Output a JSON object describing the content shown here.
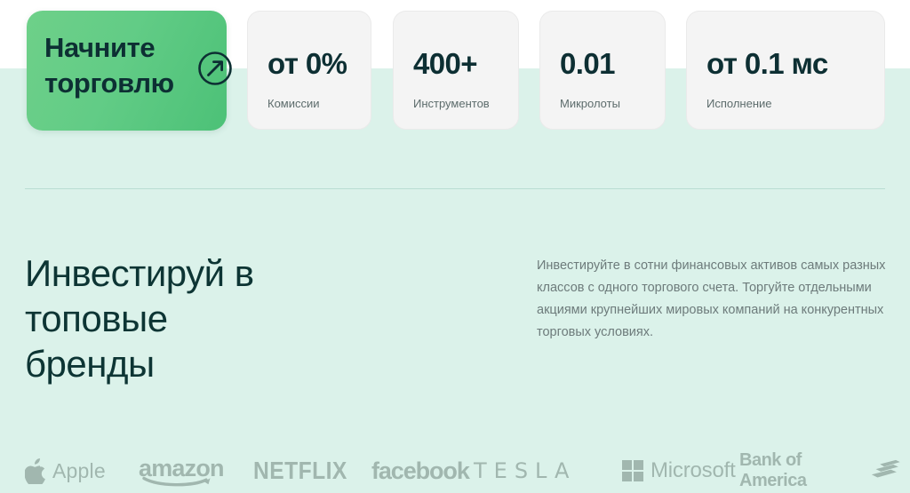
{
  "hero": {
    "cta": {
      "label": "Начните\nторговлю",
      "icon": "arrow-up-right-circle-icon",
      "gradient_from": "#6ed089",
      "gradient_to": "#4cc177",
      "text_color": "#0d2f33"
    },
    "stats": [
      {
        "value": "от 0%",
        "label": "Комиссии"
      },
      {
        "value": "400+",
        "label": "Инструментов"
      },
      {
        "value": "0.01",
        "label": "Микролоты"
      },
      {
        "value": "от 0.1 мс",
        "label": "Исполнение"
      }
    ]
  },
  "content": {
    "heading": "Инвестируй в\nтоповые\nбренды",
    "paragraph": "Инвестируйте в сотни финансовых активов самых разных классов с одного торгового счета. Торгуйте отдельными акциями крупнейших мировых компаний на конкурентных торговых условиях."
  },
  "brands": [
    {
      "name": "Apple",
      "word": "Apple",
      "icon": "apple-logo-icon"
    },
    {
      "name": "Amazon",
      "word": "amazon",
      "icon": "amazon-smile-icon"
    },
    {
      "name": "Netflix",
      "word": "NETFLIX",
      "icon": "netflix-wordmark-icon"
    },
    {
      "name": "Facebook",
      "word": "facebook",
      "icon": "facebook-wordmark-icon"
    },
    {
      "name": "Tesla",
      "word": "TESLA",
      "icon": "tesla-wordmark-icon"
    },
    {
      "name": "Microsoft",
      "word": "Microsoft",
      "icon": "microsoft-squares-icon"
    },
    {
      "name": "Bank of America",
      "word": "Bank of America",
      "icon": "bank-of-america-flag-icon"
    }
  ],
  "theme": {
    "mint_background": "#dbf2ea",
    "white_background": "#ffffff",
    "card_background": "#f4f4f4",
    "heading_color": "#0d3534",
    "paragraph_color": "#6d7b7b",
    "logo_color": "#9db3ab",
    "divider_color": "#b9ddd2"
  }
}
